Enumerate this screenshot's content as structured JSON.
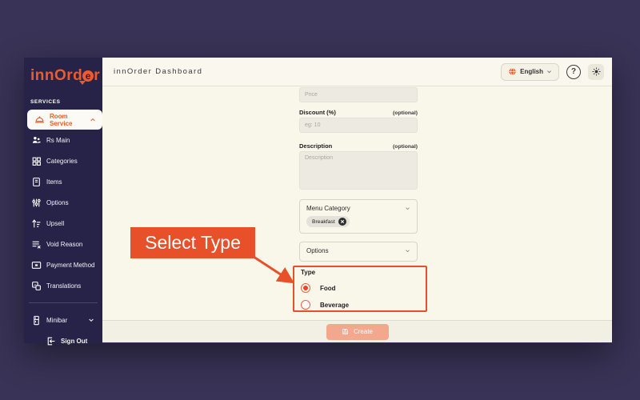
{
  "colors": {
    "background": "#393357",
    "sidebar": "#272348",
    "accent_orange": "#f05a2b",
    "annotation_orange": "#e8502a",
    "content_cream": "#f9f6ea",
    "create_salmon": "#f3a78c",
    "chip_grey": "#e4e2d9"
  },
  "sidebar": {
    "logo": "innOrder",
    "section": "SERVICES",
    "items": [
      {
        "label": "Room Service"
      },
      {
        "label": "Rs Main"
      },
      {
        "label": "Categories"
      },
      {
        "label": "Items"
      },
      {
        "label": "Options"
      },
      {
        "label": "Upsell"
      },
      {
        "label": "Void Reason"
      },
      {
        "label": "Payment Method"
      },
      {
        "label": "Translations"
      },
      {
        "label": "Minibar"
      },
      {
        "label": "Sign Out"
      }
    ]
  },
  "header": {
    "title": "innOrder Dashboard",
    "language": "English"
  },
  "form": {
    "price": {
      "placeholder": "Price"
    },
    "discount": {
      "label": "Discount (%)",
      "optional": "(optional)",
      "placeholder": "eg: 10"
    },
    "description": {
      "label": "Description",
      "optional": "(optional)",
      "placeholder": "Description"
    },
    "menu_category": {
      "label": "Menu Category",
      "chips": [
        {
          "label": "Breakfast"
        }
      ]
    },
    "options": {
      "label": "Options"
    },
    "type": {
      "label": "Type",
      "choices": [
        {
          "label": "Food",
          "selected": true
        },
        {
          "label": "Beverage",
          "selected": false
        }
      ]
    }
  },
  "annotation": {
    "label": "Select Type"
  },
  "footer": {
    "create": "Create"
  }
}
